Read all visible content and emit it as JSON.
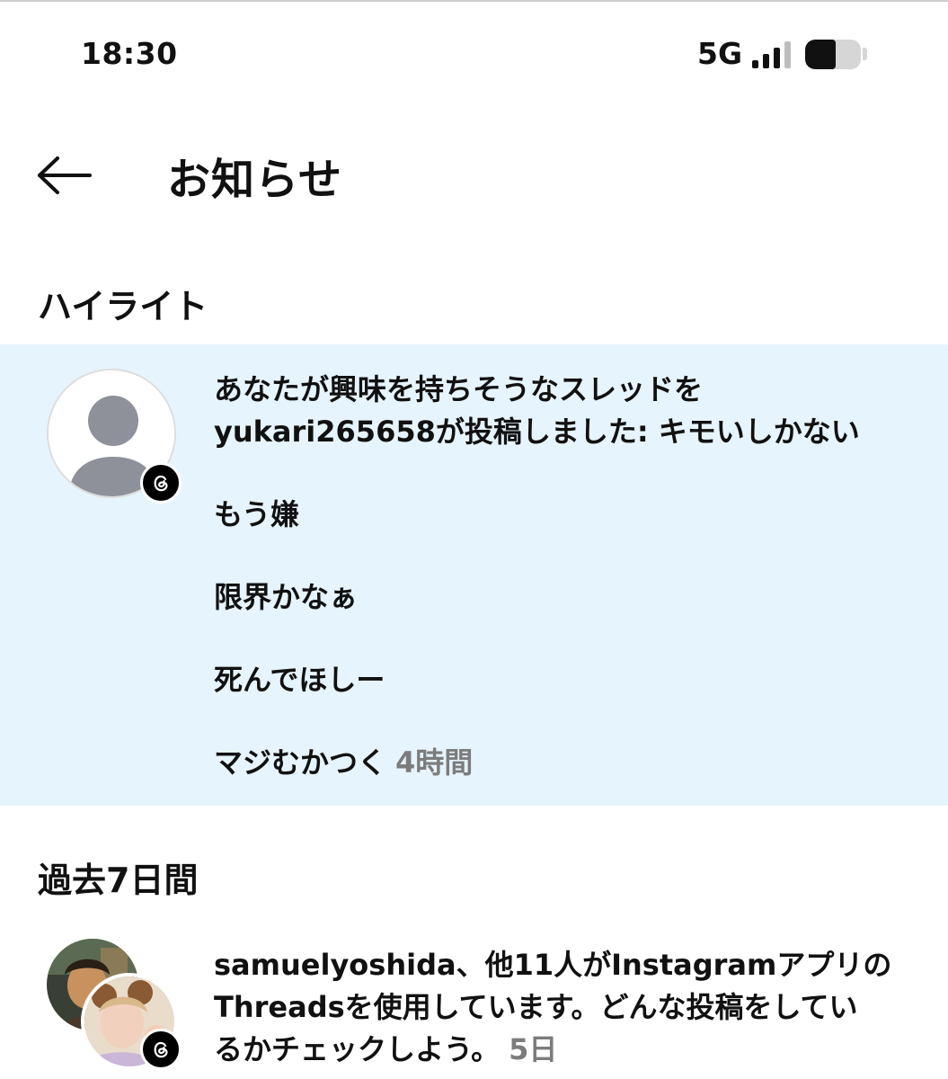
{
  "status_bar": {
    "time": "18:30",
    "network": "5G",
    "battery_level": 0.55
  },
  "header": {
    "title": "お知らせ",
    "back_icon": "arrow-left-icon"
  },
  "sections": {
    "highlight": {
      "title": "ハイライト",
      "notification": {
        "lines": [
          "あなたが興味を持ちそうなスレッドを",
          "yukari265658が投稿しました: キモいしかない",
          "もう嫌",
          "限界かなぁ",
          "死んでほしー",
          "マジむかつく"
        ],
        "time": "4時間",
        "badge_icon": "threads-icon",
        "avatar_icon": "default-user-icon"
      }
    },
    "past": {
      "title": "過去7日間",
      "notification": {
        "lines": [
          "samuelyoshida、他11人がInstagramアプリの",
          "Threadsを使用しています。どんな投稿をしてい",
          "るかチェックしよう。"
        ],
        "time": "5日",
        "badge_icon": "threads-icon"
      }
    }
  },
  "colors": {
    "highlight_background": "#e6f4fd",
    "secondary_text": "#7c7c7c"
  }
}
